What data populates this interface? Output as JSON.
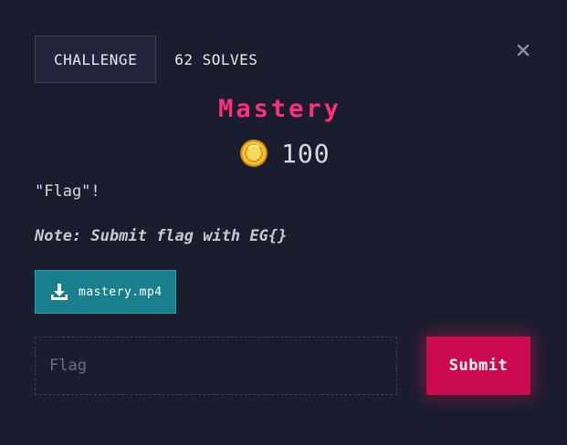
{
  "tabs": [
    {
      "label": "CHALLENGE",
      "active": true
    },
    {
      "label": "62 SOLVES",
      "active": false
    }
  ],
  "close_icon": "close-icon",
  "challenge": {
    "name": "Mastery",
    "points": "100",
    "points_icon": "coin-icon",
    "description": "\"Flag\"!",
    "note": "Note: Submit flag with EG{}"
  },
  "file": {
    "icon": "download-icon",
    "name": "mastery.mp4"
  },
  "form": {
    "placeholder": "Flag",
    "value": "",
    "submit_label": "Submit"
  },
  "colors": {
    "background": "#1a1d2e",
    "title": "#ff2f7a",
    "file_button": "#1a7f8c",
    "submit_button": "#cc0a4f"
  }
}
